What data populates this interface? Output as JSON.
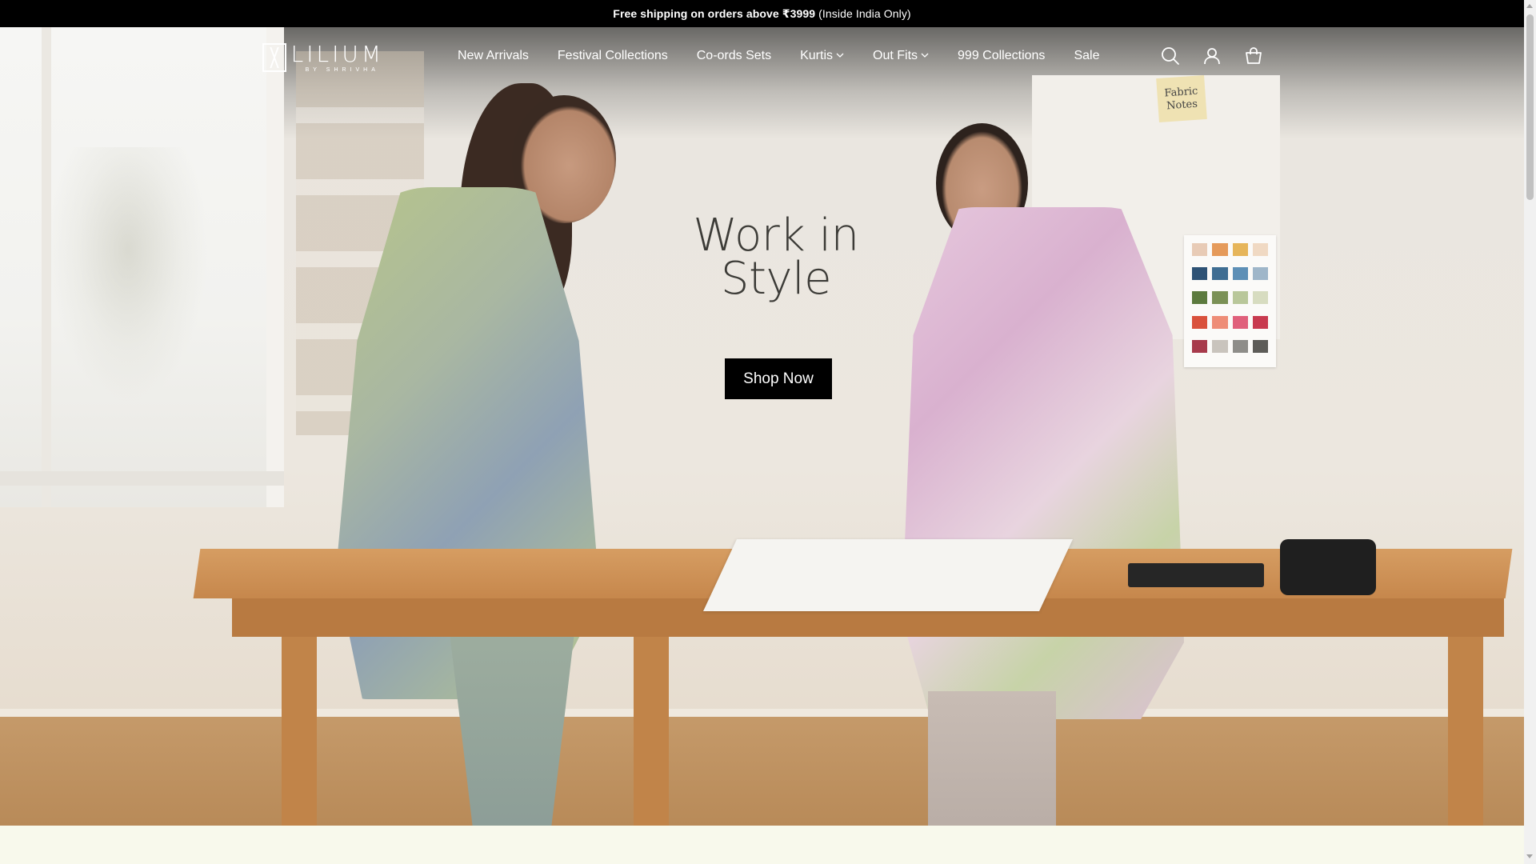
{
  "announcement": {
    "bold": "Free shipping on orders above ₹3999",
    "rest": "(Inside India Only)"
  },
  "logo": {
    "word": "LILIUM",
    "sub": "BY SHRIVHA"
  },
  "nav": {
    "items": [
      {
        "label": "New Arrivals",
        "dropdown": false
      },
      {
        "label": "Festival Collections",
        "dropdown": false
      },
      {
        "label": "Co-ords Sets",
        "dropdown": false
      },
      {
        "label": "Kurtis",
        "dropdown": true
      },
      {
        "label": "Out Fits",
        "dropdown": true
      },
      {
        "label": "999 Collections",
        "dropdown": false
      },
      {
        "label": "Sale",
        "dropdown": false
      }
    ],
    "icons": [
      "search-icon",
      "account-icon",
      "cart-icon"
    ]
  },
  "hero": {
    "title_line1": "Work in",
    "title_line2": "Style",
    "cta": "Shop Now",
    "note": "Fabric Notes"
  },
  "colors": {
    "announcement_bg": "#000000",
    "cta_bg": "#000000",
    "bottom_strip": "#f8f9ec"
  }
}
